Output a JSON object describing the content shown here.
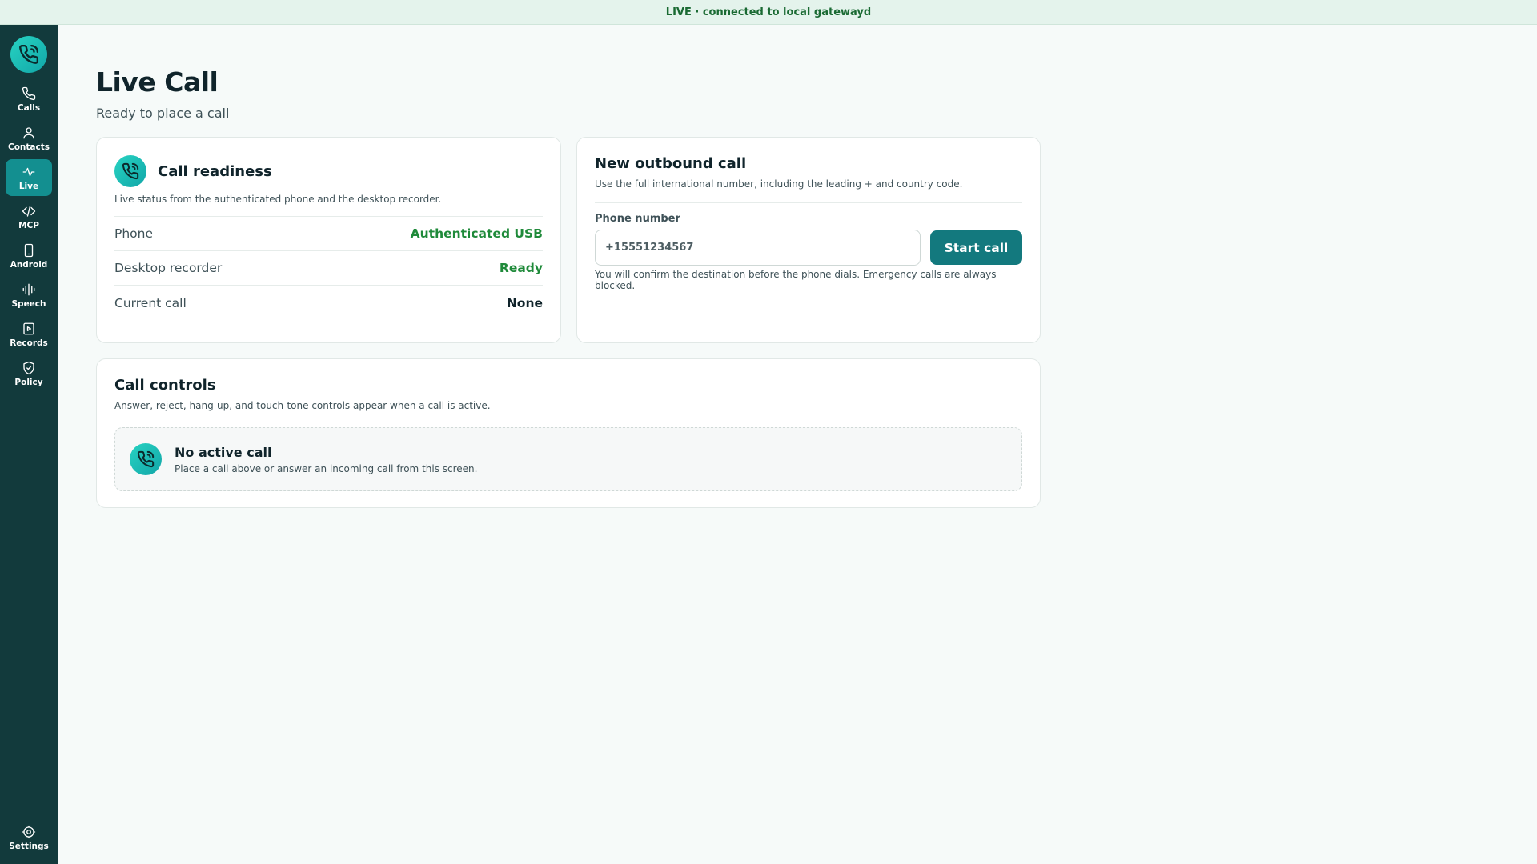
{
  "status_bar": {
    "text": "LIVE · connected to local gatewayd"
  },
  "sidebar": {
    "logo_icon": "phone-call-icon",
    "items": [
      {
        "label": "Calls",
        "icon": "phone-icon",
        "active": false
      },
      {
        "label": "Contacts",
        "icon": "user-icon",
        "active": false
      },
      {
        "label": "Live",
        "icon": "pulse-icon",
        "active": true
      },
      {
        "label": "MCP",
        "icon": "code-icon",
        "active": false
      },
      {
        "label": "Android",
        "icon": "mobile-icon",
        "active": false
      },
      {
        "label": "Speech",
        "icon": "waveform-icon",
        "active": false
      },
      {
        "label": "Records",
        "icon": "play-file-icon",
        "active": false
      },
      {
        "label": "Policy",
        "icon": "shield-check-icon",
        "active": false
      }
    ],
    "settings": {
      "label": "Settings",
      "icon": "gear-icon"
    }
  },
  "page": {
    "title": "Live Call",
    "subtitle": "Ready to place a call"
  },
  "readiness": {
    "title": "Call readiness",
    "description": "Live status from the authenticated phone and the desktop recorder.",
    "rows": [
      {
        "label": "Phone",
        "value": "Authenticated USB",
        "status": "ok"
      },
      {
        "label": "Desktop recorder",
        "value": "Ready",
        "status": "ok"
      },
      {
        "label": "Current call",
        "value": "None",
        "status": "neutral"
      }
    ]
  },
  "outbound": {
    "title": "New outbound call",
    "description": "Use the full international number, including the leading + and country code.",
    "field_label": "Phone number",
    "placeholder": "+15551234567",
    "value": "",
    "button_label": "Start call",
    "hint": "You will confirm the destination before the phone dials. Emergency calls are always blocked."
  },
  "controls": {
    "title": "Call controls",
    "description": "Answer, reject, hang-up, and touch-tone controls appear when a call is active.",
    "empty_title": "No active call",
    "empty_description": "Place a call above or answer an incoming call from this screen."
  },
  "colors": {
    "sidebar_bg": "#123a3c",
    "accent": "#13797e",
    "active_nav": "#138f90",
    "ok": "#1f8a3a",
    "status_bar_bg": "#e4f3ec"
  }
}
